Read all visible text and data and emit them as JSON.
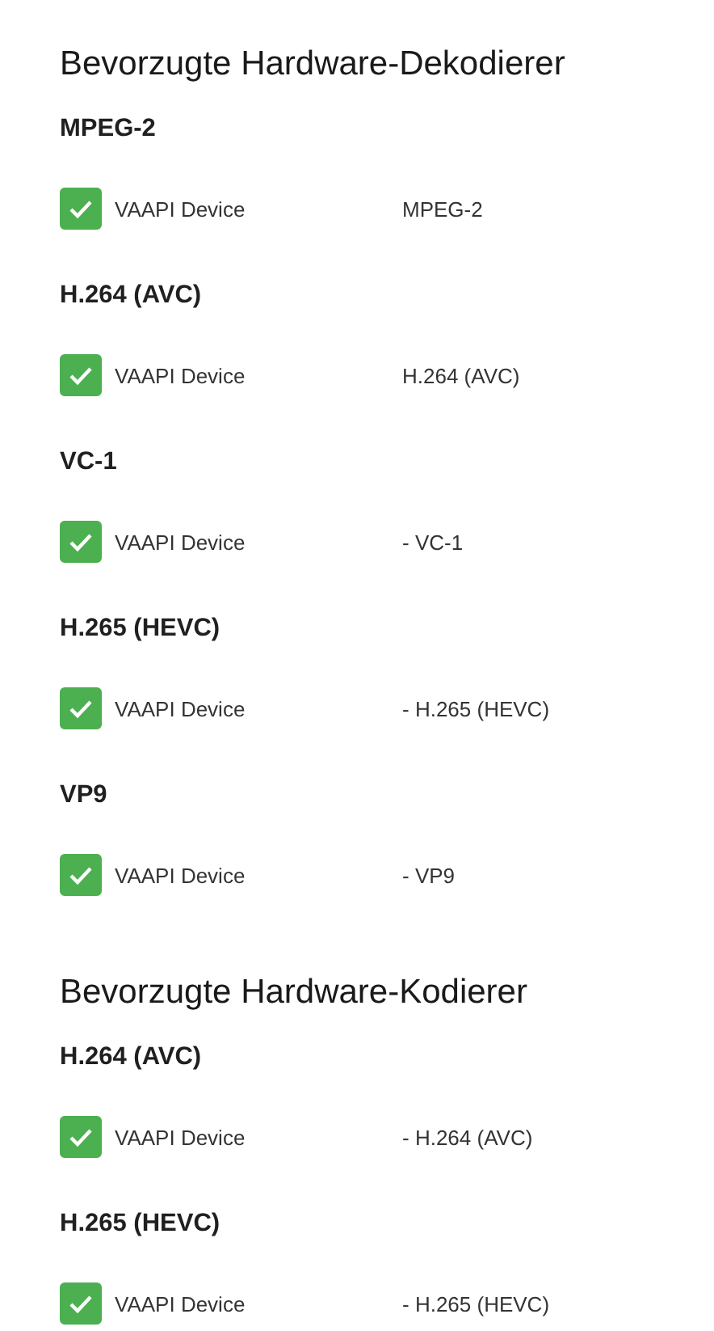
{
  "sections": [
    {
      "title": "Bevorzugte Hardware-Dekodierer",
      "groups": [
        {
          "heading": "MPEG-2",
          "device": {
            "label": "VAAPI Device",
            "codec": "MPEG-2",
            "checked": true
          }
        },
        {
          "heading": "H.264 (AVC)",
          "device": {
            "label": "VAAPI Device",
            "codec": "H.264 (AVC)",
            "checked": true
          }
        },
        {
          "heading": "VC-1",
          "device": {
            "label": "VAAPI Device",
            "codec": "- VC-1",
            "checked": true
          }
        },
        {
          "heading": "H.265 (HEVC)",
          "device": {
            "label": "VAAPI Device",
            "codec": "- H.265 (HEVC)",
            "checked": true
          }
        },
        {
          "heading": "VP9",
          "device": {
            "label": "VAAPI Device",
            "codec": "- VP9",
            "checked": true
          }
        }
      ]
    },
    {
      "title": "Bevorzugte Hardware-Kodierer",
      "groups": [
        {
          "heading": "H.264 (AVC)",
          "device": {
            "label": "VAAPI Device",
            "codec": "- H.264 (AVC)",
            "checked": true
          }
        },
        {
          "heading": "H.265 (HEVC)",
          "device": {
            "label": "VAAPI Device",
            "codec": "- H.265 (HEVC)",
            "checked": true
          }
        }
      ]
    }
  ]
}
